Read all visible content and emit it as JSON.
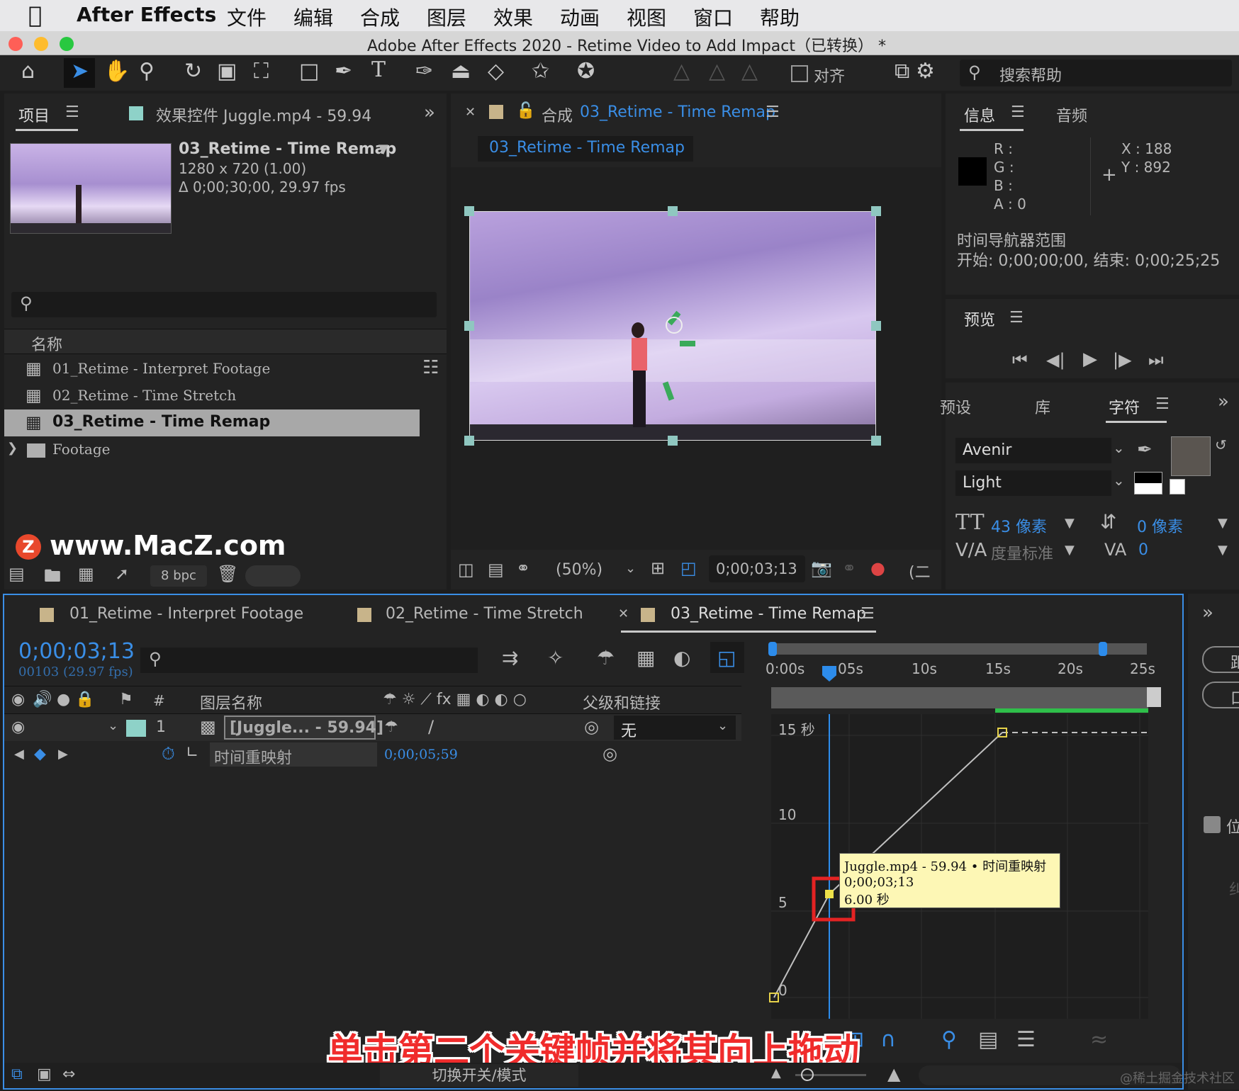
{
  "menubar": {
    "app": "After Effects",
    "items": [
      "文件",
      "编辑",
      "合成",
      "图层",
      "效果",
      "动画",
      "视图",
      "窗口",
      "帮助"
    ]
  },
  "window": {
    "title": "Adobe After Effects 2020 - Retime Video to Add Impact（已转换） *"
  },
  "toolbar": {
    "align_label": "对齐",
    "search_help": "搜索帮助"
  },
  "project_panel": {
    "tab_project": "项目",
    "tab_effects": "效果控件 Juggle.mp4 - 59.94",
    "comp_name": "03_Retime - Time Remap",
    "comp_size": "1280 x 720 (1.00)",
    "comp_duration": "Δ 0;00;30;00, 29.97 fps",
    "column_name": "名称",
    "items": [
      "01_Retime - Interpret Footage",
      "02_Retime - Time Stretch",
      "03_Retime - Time Remap",
      "Footage"
    ],
    "bpc": "8 bpc",
    "watermark": "www.MacZ.com"
  },
  "comp_panel": {
    "tab_prefix": "合成",
    "tab_name": "03_Retime - Time Remap",
    "subtab": "03_Retime - Time Remap",
    "zoom": "(50%)",
    "timecode": "0;00;03;13"
  },
  "info_panel": {
    "tab_info": "信息",
    "tab_audio": "音频",
    "r": "R :",
    "g": "G :",
    "b": "B :",
    "a": "A :  0",
    "x": "X : 188",
    "y": "Y : 892",
    "nav_title": "时间导航器范围",
    "nav_range": "开始: 0;00;00;00,   结束: 0;00;25;25"
  },
  "preview_panel": {
    "title": "预览"
  },
  "character_panel": {
    "tab_presets": "预设",
    "tab_library": "库",
    "tab_character": "字符",
    "font": "Avenir",
    "style": "Light",
    "font_size": "43 像素",
    "leading": "0 像素",
    "kerning": "度量标准",
    "tracking": "0"
  },
  "timeline": {
    "tabs": [
      "01_Retime - Interpret Footage",
      "02_Retime - Time Stretch",
      "03_Retime - Time Remap"
    ],
    "timecode": "0;00;03;13",
    "frames": "00103 (29.97 fps)",
    "col_layer_name": "图层名称",
    "col_parent": "父级和链接",
    "layer_num": "1",
    "layer_name": "[Juggle... - 59.94]",
    "parent_value": "无",
    "property_name": "时间重映射",
    "property_value": "0;00;05;59",
    "ruler": [
      "0:00s",
      "05s",
      "10s",
      "15s",
      "20s",
      "25s"
    ],
    "graph_y": [
      "15 秒",
      "10",
      "5",
      "0"
    ],
    "tooltip": [
      "Juggle.mp4 - 59.94 • 时间重映射",
      "0;00;03;13",
      "6.00 秒"
    ],
    "toggle_label": "切换开关/模式",
    "instruction": "单击第二个关键帧并将其向上拖动",
    "credit": "@稀土掘金技术社区",
    "right_edge": [
      "距",
      "口",
      "位",
      "纠"
    ]
  }
}
